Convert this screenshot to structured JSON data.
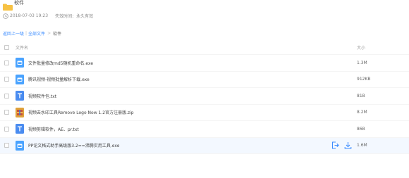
{
  "folder": {
    "name": "软件",
    "created": "2018-07-03 19:23",
    "expiry_label": "失效时间：永久有效"
  },
  "breadcrumb": {
    "back": "返回上一级",
    "all_files": "全部文件",
    "current": "软件"
  },
  "columns": {
    "name": "文件名",
    "size": "大小"
  },
  "files": [
    {
      "name": "文件批量修改md5随机重命名.exe",
      "size": "1.3M",
      "type": "exe"
    },
    {
      "name": "腾讯视频-视频批量解析下载.exe",
      "size": "912KB",
      "type": "exe"
    },
    {
      "name": "视频软件包.txt",
      "size": "81B",
      "type": "txt"
    },
    {
      "name": "视频去水印工具Remove Logo Now 1.2官方注册版.zip",
      "size": "8.2M",
      "type": "zip"
    },
    {
      "name": "视频剪辑软件，AE、pr.txt",
      "size": "86B",
      "type": "txt"
    },
    {
      "name": "PP论文格式助手高级版3.2==沸腾实用工具.exe",
      "size": "1.6M",
      "type": "exe"
    }
  ],
  "colors": {
    "link": "#3b8cff",
    "exe_icon": "#4aa3ff",
    "txt_icon": "#4a8cf0",
    "zip_icon": "#e0a23a",
    "folder": "#f7c244"
  },
  "icons": {
    "folder": "folder-icon",
    "clock": "clock-icon",
    "save": "save-to-drive-icon",
    "download": "download-icon"
  }
}
